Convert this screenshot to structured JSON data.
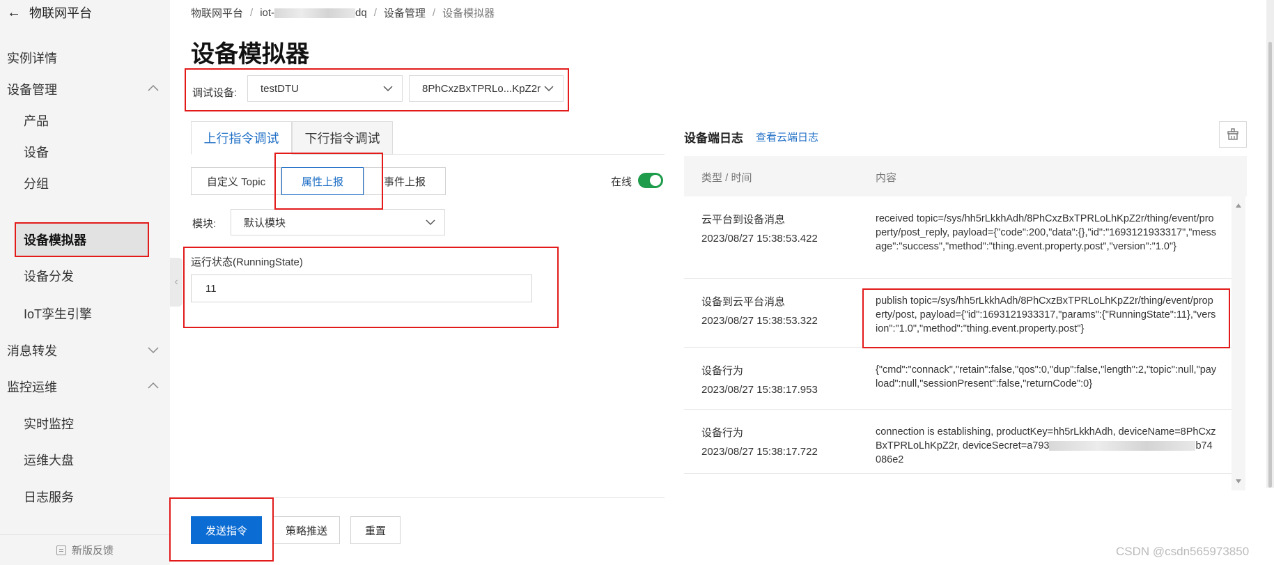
{
  "sidebar": {
    "back_title": "物联网平台",
    "items": [
      {
        "label": "实例详情"
      },
      {
        "label": "设备管理"
      },
      {
        "label": "产品"
      },
      {
        "label": "设备"
      },
      {
        "label": "分组"
      },
      {
        "label": "设备模拟器"
      },
      {
        "label": "设备分发"
      },
      {
        "label": "IoT孪生引擎"
      },
      {
        "label": "消息转发"
      },
      {
        "label": "监控运维"
      },
      {
        "label": "实时监控"
      },
      {
        "label": "运维大盘"
      },
      {
        "label": "日志服务"
      }
    ],
    "footer": "新版反馈"
  },
  "breadcrumb": {
    "item1": "物联网平台",
    "item2_prefix": "iot-",
    "item2_suffix": "dq",
    "item3": "设备管理",
    "item4": "设备模拟器",
    "sep": "/"
  },
  "title": "设备模拟器",
  "debug": {
    "label": "调试设备:",
    "product": "testDTU",
    "device": "8PhCxzBxTPRLo...KpZ2r"
  },
  "tabs": {
    "upstream": "上行指令调试",
    "downstream": "下行指令调试"
  },
  "subtabs": {
    "custom": "自定义 Topic",
    "property": "属性上报",
    "event": "事件上报"
  },
  "online": {
    "label": "在线",
    "on": true
  },
  "module": {
    "label": "模块:",
    "value": "默认模块"
  },
  "property_field": {
    "label": "运行状态(RunningState)",
    "value": "11"
  },
  "actions": {
    "send": "发送指令",
    "strategy": "策略推送",
    "reset": "重置"
  },
  "log": {
    "title": "设备端日志",
    "link": "查看云端日志",
    "col_type": "类型 / 时间",
    "col_content": "内容",
    "rows": [
      {
        "type": "云平台到设备消息",
        "time": "2023/08/27 15:38:53.422",
        "content": "received topic=/sys/hh5rLkkhAdh/8PhCxzBxTPRLoLhKpZ2r/thing/event/property/post_reply, payload={\"code\":200,\"data\":{},\"id\":\"1693121933317\",\"message\":\"success\",\"method\":\"thing.event.property.post\",\"version\":\"1.0\"}"
      },
      {
        "type": "设备到云平台消息",
        "time": "2023/08/27 15:38:53.322",
        "content": "publish topic=/sys/hh5rLkkhAdh/8PhCxzBxTPRLoLhKpZ2r/thing/event/property/post, payload={\"id\":1693121933317,\"params\":{\"RunningState\":11},\"version\":\"1.0\",\"method\":\"thing.event.property.post\"}"
      },
      {
        "type": "设备行为",
        "time": "2023/08/27 15:38:17.953",
        "content": "{\"cmd\":\"connack\",\"retain\":false,\"qos\":0,\"dup\":false,\"length\":2,\"topic\":null,\"payload\":null,\"sessionPresent\":false,\"returnCode\":0}"
      },
      {
        "type": "设备行为",
        "time": "2023/08/27 15:38:17.722",
        "content_prefix": "connection is establishing, productKey=hh5rLkkhAdh, deviceName=8PhCxzBxTPRLoLhKpZ2r, deviceSecret=a793",
        "content_suffix": "b74086e2"
      }
    ]
  },
  "watermark": "CSDN @csdn565973850",
  "colors": {
    "accent": "#1f6fc6",
    "primary_button": "#0b6cd4",
    "toggle_on": "#1e9b4b",
    "annotation": "#e21a1a"
  }
}
